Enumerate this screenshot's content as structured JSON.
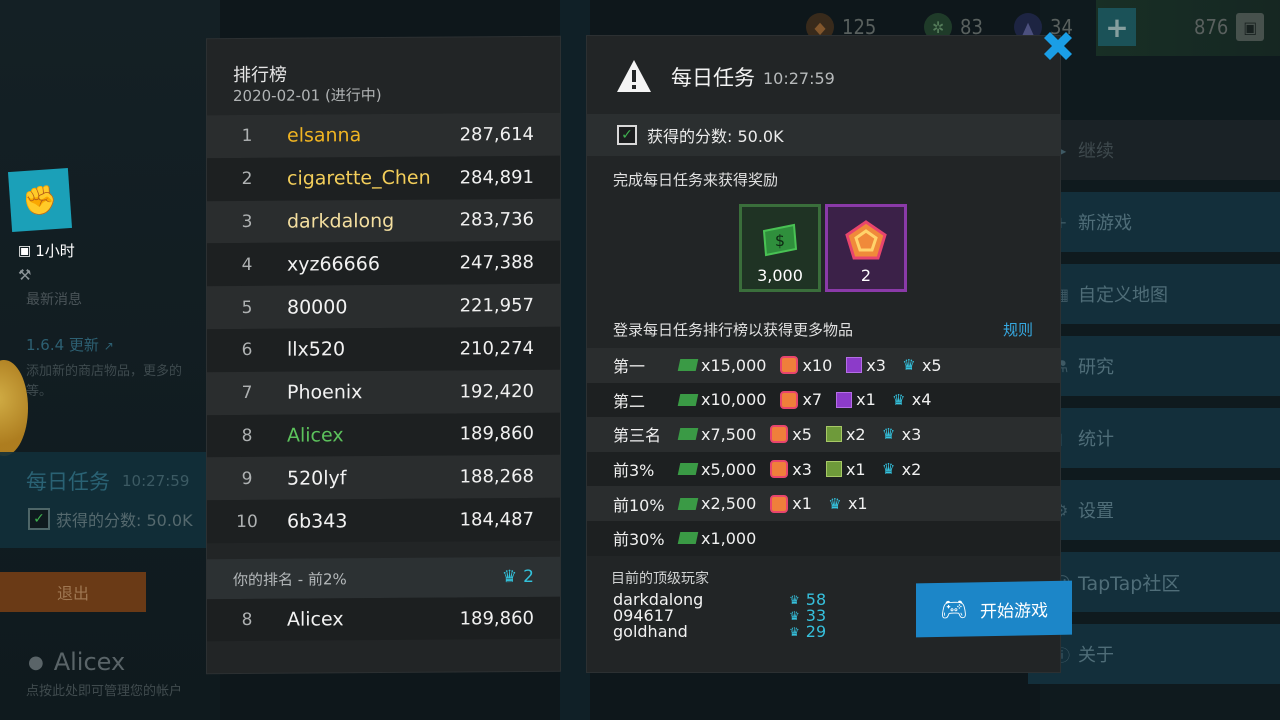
{
  "topbar": {
    "res1_value": "125",
    "res2_value": "83",
    "res3_value": "34",
    "res4_value": "876"
  },
  "sidebar": {
    "timer_text": "1小时",
    "news_label": "最新消息",
    "version_link": "1.6.4 更新",
    "version_desc": "添加新的商店物品，更多的\n等。",
    "daily_title": "每日任务",
    "daily_time": "10:27:59",
    "score_text": "获得的分数: 50.0K",
    "exit_label": "退出",
    "username": "Alicex",
    "user_hint": "点按此处即可管理您的帐户"
  },
  "right_menu": [
    {
      "label": "继续",
      "icon": "play-icon"
    },
    {
      "label": "新游戏",
      "icon": "plus-icon"
    },
    {
      "label": "自定义地图",
      "icon": "map-icon"
    },
    {
      "label": "研究",
      "icon": "flask-icon"
    },
    {
      "label": "统计",
      "icon": "stats-icon"
    },
    {
      "label": "设置",
      "icon": "gear-icon"
    },
    {
      "label": "TapTap社区",
      "icon": "community-icon"
    },
    {
      "label": "关于",
      "icon": "info-icon"
    }
  ],
  "leaderboard": {
    "title": "排行榜",
    "date": "2020-02-01 (进行中)",
    "rows": [
      {
        "rank": "1",
        "name": "elsanna",
        "score": "287,614",
        "color": "#f0b422"
      },
      {
        "rank": "2",
        "name": "cigarette_Chen",
        "score": "284,891",
        "color": "#f3ce5a"
      },
      {
        "rank": "3",
        "name": "darkdalong",
        "score": "283,736",
        "color": "#f4dfa0"
      },
      {
        "rank": "4",
        "name": "xyz66666",
        "score": "247,388",
        "color": "#f2f2f2"
      },
      {
        "rank": "5",
        "name": "80000",
        "score": "221,957",
        "color": "#f2f2f2"
      },
      {
        "rank": "6",
        "name": "llx520",
        "score": "210,274",
        "color": "#f2f2f2"
      },
      {
        "rank": "7",
        "name": "Phoenix",
        "score": "192,420",
        "color": "#f2f2f2"
      },
      {
        "rank": "8",
        "name": "Alicex",
        "score": "189,860",
        "color": "#5cc25c"
      },
      {
        "rank": "9",
        "name": "520lyf",
        "score": "188,268",
        "color": "#f2f2f2"
      },
      {
        "rank": "10",
        "name": "6b343",
        "score": "184,487",
        "color": "#f2f2f2"
      }
    ],
    "my_rank_label": "你的排名 - 前2%",
    "my_rank_crowns": "2",
    "my_row": {
      "rank": "8",
      "name": "Alicex",
      "score": "189,860"
    }
  },
  "daily": {
    "title": "每日任务",
    "time": "10:27:59",
    "score_text": "获得的分数: 50.0K",
    "reward_label": "完成每日任务来获得奖励",
    "reward_cash": "3,000",
    "reward_badge": "2",
    "lb_label": "登录每日任务排行榜以获得更多物品",
    "rules_label": "规则",
    "tiers": [
      {
        "label": "第一",
        "items": [
          {
            "type": "cash",
            "text": "x15,000"
          },
          {
            "type": "badge",
            "text": "x10"
          },
          {
            "type": "cube-p",
            "text": "x3"
          },
          {
            "type": "crown",
            "text": "x5"
          }
        ]
      },
      {
        "label": "第二",
        "items": [
          {
            "type": "cash",
            "text": "x10,000"
          },
          {
            "type": "badge",
            "text": "x7"
          },
          {
            "type": "cube-p",
            "text": "x1"
          },
          {
            "type": "crown",
            "text": "x4"
          }
        ]
      },
      {
        "label": "第三名",
        "items": [
          {
            "type": "cash",
            "text": "x7,500"
          },
          {
            "type": "badge",
            "text": "x5"
          },
          {
            "type": "cube-g",
            "text": "x2"
          },
          {
            "type": "crown",
            "text": "x3"
          }
        ]
      },
      {
        "label": "前3%",
        "items": [
          {
            "type": "cash",
            "text": "x5,000"
          },
          {
            "type": "badge",
            "text": "x3"
          },
          {
            "type": "cube-g",
            "text": "x1"
          },
          {
            "type": "crown",
            "text": "x2"
          }
        ]
      },
      {
        "label": "前10%",
        "items": [
          {
            "type": "cash",
            "text": "x2,500"
          },
          {
            "type": "badge",
            "text": "x1"
          },
          {
            "type": "crown",
            "text": "x1"
          }
        ]
      },
      {
        "label": "前30%",
        "items": [
          {
            "type": "cash",
            "text": "x1,000"
          }
        ]
      }
    ],
    "top_label": "目前的顶级玩家",
    "top_players": [
      {
        "name": "darkdalong",
        "crowns": "58"
      },
      {
        "name": "094617",
        "crowns": "33"
      },
      {
        "name": "goldhand",
        "crowns": "29"
      }
    ],
    "play_label": "开始游戏"
  }
}
